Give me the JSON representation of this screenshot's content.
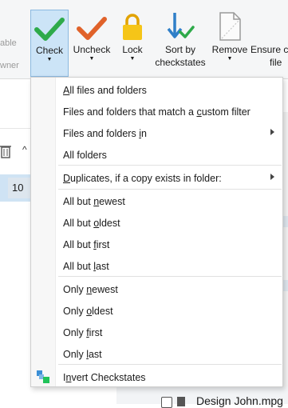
{
  "ribbon": {
    "left_cut_1": "able",
    "left_cut_2": "wner",
    "check": {
      "label": "Check"
    },
    "uncheck": {
      "label": "Uncheck"
    },
    "lock": {
      "label": "Lock"
    },
    "sort": {
      "label_1": "Sort by",
      "label_2": "checkstates"
    },
    "remove": {
      "label": "Remove"
    },
    "ensure": {
      "label_1": "Ensure c",
      "label_2": "file"
    }
  },
  "background": {
    "count_cell": "10",
    "partial_file": "Design John.mpg"
  },
  "menu": {
    "items": [
      {
        "pre": "",
        "ul": "A",
        "post": "ll files and folders"
      },
      {
        "pre": "Files and folders that match a ",
        "ul": "c",
        "post": "ustom filter"
      },
      {
        "pre": "Files and folders ",
        "ul": "i",
        "post": "n"
      },
      {
        "pre": "All folders",
        "ul": "",
        "post": ""
      },
      {
        "pre": "",
        "ul": "D",
        "post": "uplicates, if a copy exists in folder:"
      },
      {
        "pre": "All but ",
        "ul": "n",
        "post": "ewest"
      },
      {
        "pre": "All but ",
        "ul": "o",
        "post": "ldest"
      },
      {
        "pre": "All but ",
        "ul": "f",
        "post": "irst"
      },
      {
        "pre": "All but ",
        "ul": "l",
        "post": "ast"
      },
      {
        "pre": "Only ",
        "ul": "n",
        "post": "ewest"
      },
      {
        "pre": "Only ",
        "ul": "o",
        "post": "ldest"
      },
      {
        "pre": "Only ",
        "ul": "f",
        "post": "irst"
      },
      {
        "pre": "Only ",
        "ul": "l",
        "post": "ast"
      },
      {
        "pre": "I",
        "ul": "n",
        "post": "vert Checkstates"
      }
    ]
  },
  "colors": {
    "check_green": "#2eaa4a",
    "uncheck_orange": "#e0622a",
    "lock_yellow": "#f5c518",
    "sort_blue": "#2f7fc8",
    "selected_bg": "#cce4f7"
  }
}
